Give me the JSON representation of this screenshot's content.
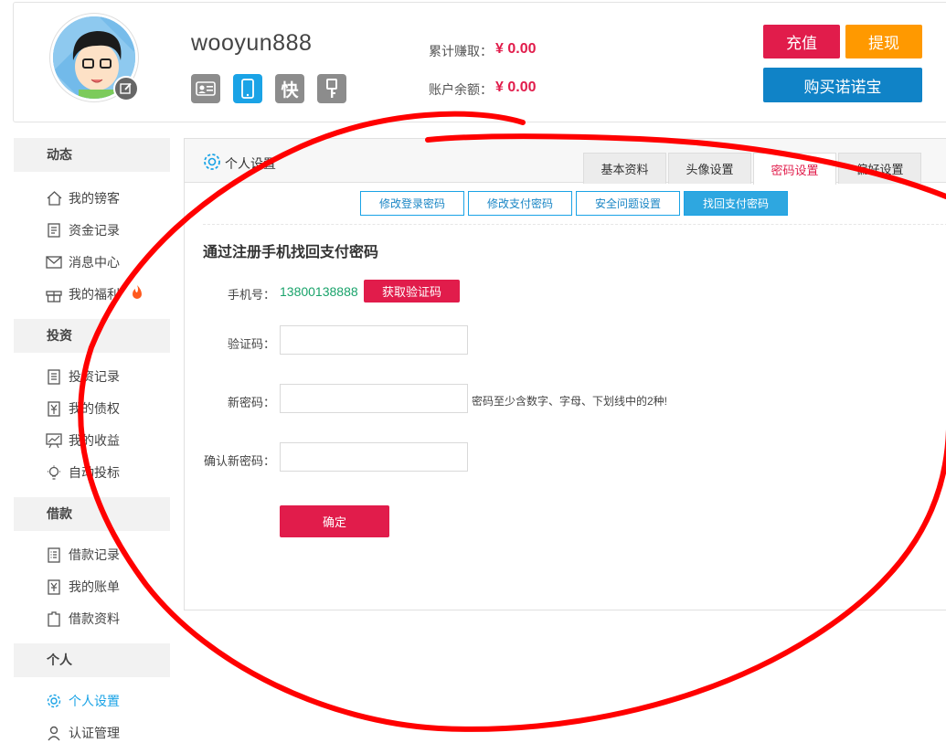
{
  "header": {
    "username": "wooyun888",
    "stats": [
      {
        "label": "累计赚取：",
        "value": "¥ 0.00"
      },
      {
        "label": "账户余额：",
        "value": "¥ 0.00"
      }
    ],
    "buttons": {
      "recharge": "充值",
      "withdraw": "提现",
      "buy": "购买诺诺宝"
    },
    "badges": [
      "id-card-icon",
      "phone-icon",
      "快",
      "key-icon"
    ],
    "colors": {
      "accent_red": "#e11c4b",
      "accent_orange": "#ff9900",
      "accent_blue": "#1083c7"
    }
  },
  "sidebar": {
    "sections": [
      {
        "title": "动态",
        "items": [
          "我的镑客",
          "资金记录",
          "消息中心",
          "我的福利"
        ]
      },
      {
        "title": "投资",
        "items": [
          "投资记录",
          "我的债权",
          "我的收益",
          "自动投标"
        ]
      },
      {
        "title": "借款",
        "items": [
          "借款记录",
          "我的账单",
          "借款资料"
        ]
      },
      {
        "title": "个人",
        "items": [
          "个人设置",
          "认证管理"
        ]
      }
    ]
  },
  "panel": {
    "title": "个人设置",
    "tabs": [
      "基本资料",
      "头像设置",
      "密码设置",
      "偏好设置"
    ],
    "active_tab": "密码设置",
    "subtabs": [
      "修改登录密码",
      "修改支付密码",
      "安全问题设置",
      "找回支付密码"
    ],
    "active_subtab": "找回支付密码",
    "section_title": "通过注册手机找回支付密码",
    "form": {
      "phone_label": "手机号：",
      "phone_value": "13800138888",
      "sms_button": "获取验证码",
      "code_label": "验证码：",
      "new_password_label": "新密码：",
      "password_hint": "密码至少含数字、字母、下划线中的2种!",
      "confirm_password_label": "确认新密码：",
      "submit": "确定"
    }
  }
}
